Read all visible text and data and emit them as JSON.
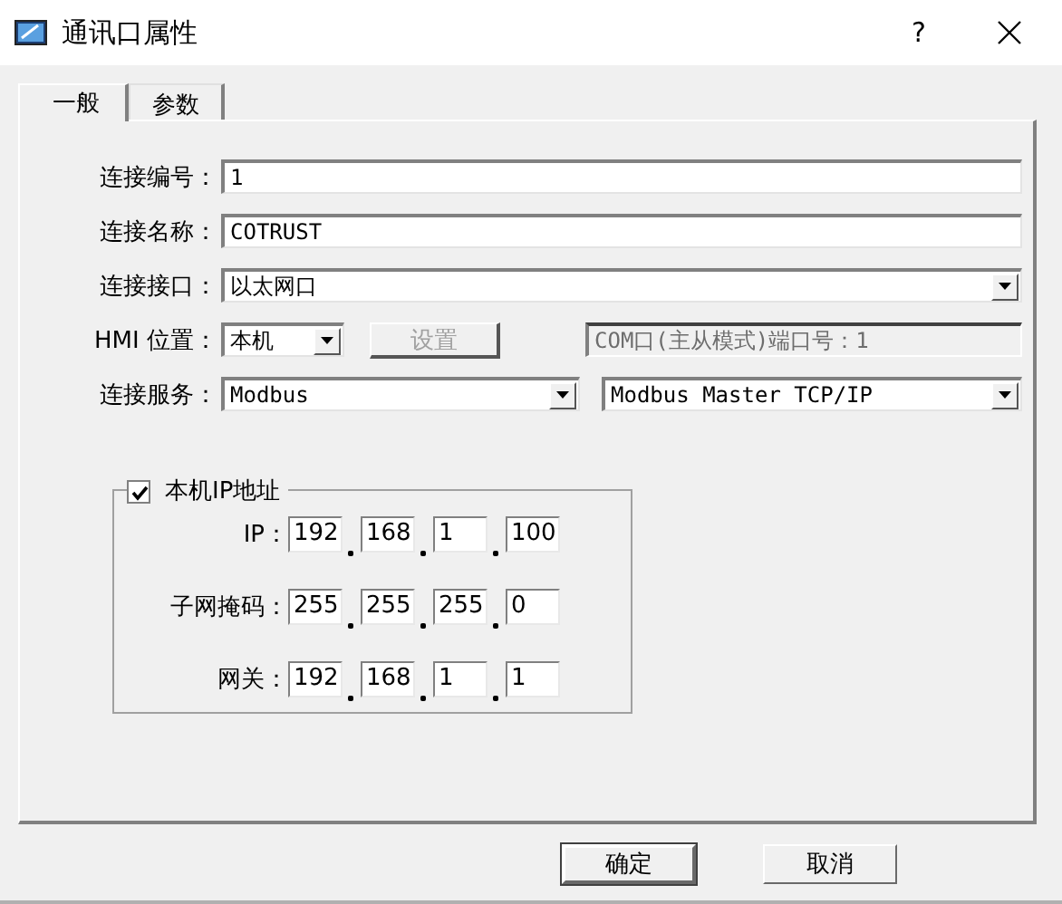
{
  "window": {
    "title": "通讯口属性",
    "help": "?"
  },
  "tabs": [
    {
      "label": "一般",
      "selected": true
    },
    {
      "label": "参数",
      "selected": false
    }
  ],
  "form": {
    "rows": [
      {
        "label": "连接编号：",
        "controls": [
          {
            "kind": "text",
            "value": "1"
          }
        ]
      },
      {
        "label": "连接名称：",
        "controls": [
          {
            "kind": "text",
            "value": "COTRUST"
          }
        ]
      },
      {
        "label": "连接接口：",
        "controls": [
          {
            "kind": "select",
            "value": "以太网口"
          }
        ]
      },
      {
        "label": "HMI 位置：",
        "controls": [
          {
            "kind": "select",
            "value": "本机"
          },
          {
            "kind": "button",
            "label": "设置",
            "disabled": true
          },
          {
            "kind": "text",
            "value": "COM口(主从模式)端口号：1",
            "disabled": true
          }
        ]
      },
      {
        "label": "连接服务：",
        "controls": [
          {
            "kind": "select",
            "value": "Modbus"
          },
          {
            "kind": "select",
            "value": "Modbus Master TCP/IP"
          }
        ]
      }
    ]
  },
  "ip_group": {
    "label": "本机IP地址",
    "checked": true,
    "rows": [
      {
        "label": "IP：",
        "octets": [
          "192",
          "168",
          "1",
          "100"
        ]
      },
      {
        "label": "子网掩码：",
        "octets": [
          "255",
          "255",
          "255",
          "0"
        ]
      },
      {
        "label": "网关：",
        "octets": [
          "192",
          "168",
          "1",
          "1"
        ]
      }
    ]
  },
  "buttons": [
    {
      "label": "确定",
      "default": true
    },
    {
      "label": "取消",
      "default": false
    }
  ]
}
